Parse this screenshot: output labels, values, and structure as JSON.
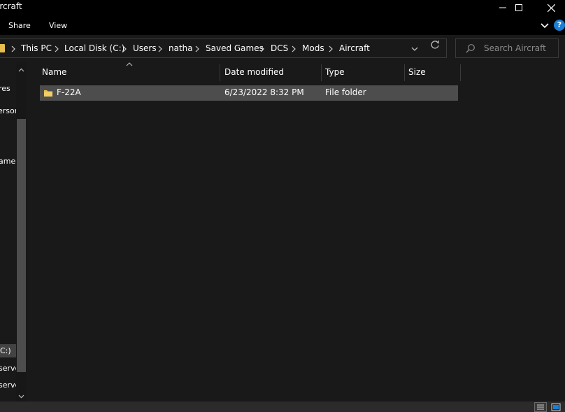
{
  "window": {
    "title": "ircraft"
  },
  "ribbon": {
    "tabs": [
      "Share",
      "View"
    ]
  },
  "address": {
    "crumbs": [
      "This PC",
      "Local Disk (C:)",
      "Users",
      "natha",
      "Saved Games",
      "DCS",
      "Mods",
      "Aircraft"
    ]
  },
  "search": {
    "placeholder": "Search Aircraft"
  },
  "nav": {
    "items": [
      {
        "label": "res"
      },
      {
        "label": "erson"
      },
      {
        "label": "amer"
      },
      {
        "label": "C:)"
      },
      {
        "label": "serve"
      },
      {
        "label": "serve"
      }
    ]
  },
  "columns": {
    "name": "Name",
    "date": "Date modified",
    "type": "Type",
    "size": "Size"
  },
  "files": [
    {
      "name": "F-22A",
      "date": "6/23/2022 8:32 PM",
      "type": "File folder",
      "size": ""
    }
  ],
  "colors": {
    "background": "#191919",
    "chrome": "#000000",
    "selection": "#4d4d4d",
    "folder": "#e8bf4e",
    "help": "#1a7fd6"
  }
}
